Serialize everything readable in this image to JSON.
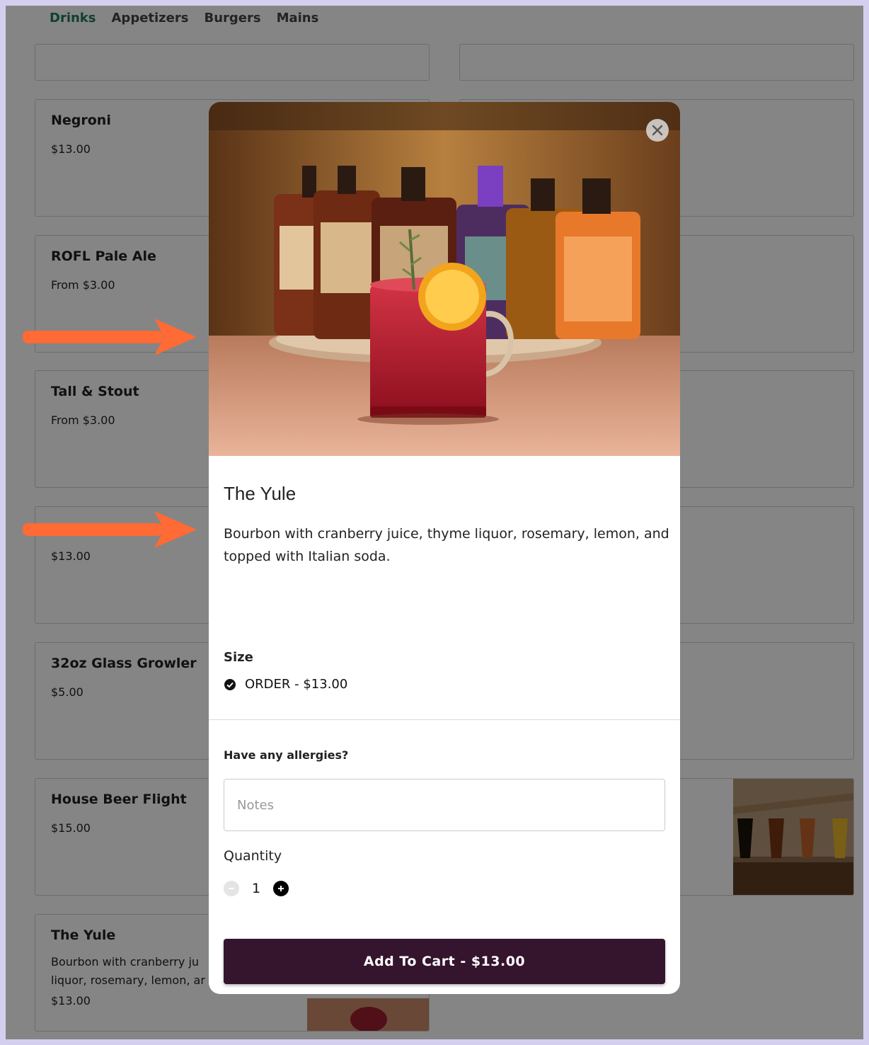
{
  "tabs": [
    "Drinks",
    "Appetizers",
    "Burgers",
    "Mains"
  ],
  "menu_items": [
    {
      "name": "Negroni",
      "price": "$13.00"
    },
    {
      "name": "ROFL Pale Ale",
      "price": "From $3.00"
    },
    {
      "name": "Tall & Stout",
      "price": "From $3.00"
    },
    {
      "name": "",
      "price": "$13.00"
    },
    {
      "name": "32oz Glass Growler",
      "price": "$5.00"
    },
    {
      "name": "House Beer Flight",
      "price": "$15.00"
    },
    {
      "name": "The Yule",
      "desc": "Bourbon with cranberry ju\nliquor, rosemary, lemon, ar",
      "price": "$13.00"
    }
  ],
  "modal": {
    "image_icon": "cocktail-photo",
    "title": "The Yule",
    "description": "Bourbon with cranberry juice, thyme liquor, rosemary, lemon, and topped with Italian soda.",
    "size_label": "Size",
    "size_option": "ORDER - $13.00",
    "allergy_label": "Have any allergies?",
    "notes_placeholder": "Notes",
    "quantity_label": "Quantity",
    "quantity_value": "1",
    "cart_button": "Add To Cart - $13.00"
  },
  "colors": {
    "active_tab": "#1f7a63",
    "cart_button": "#35142d",
    "arrow": "#ff6a35",
    "page_border": "#d4cfee"
  }
}
